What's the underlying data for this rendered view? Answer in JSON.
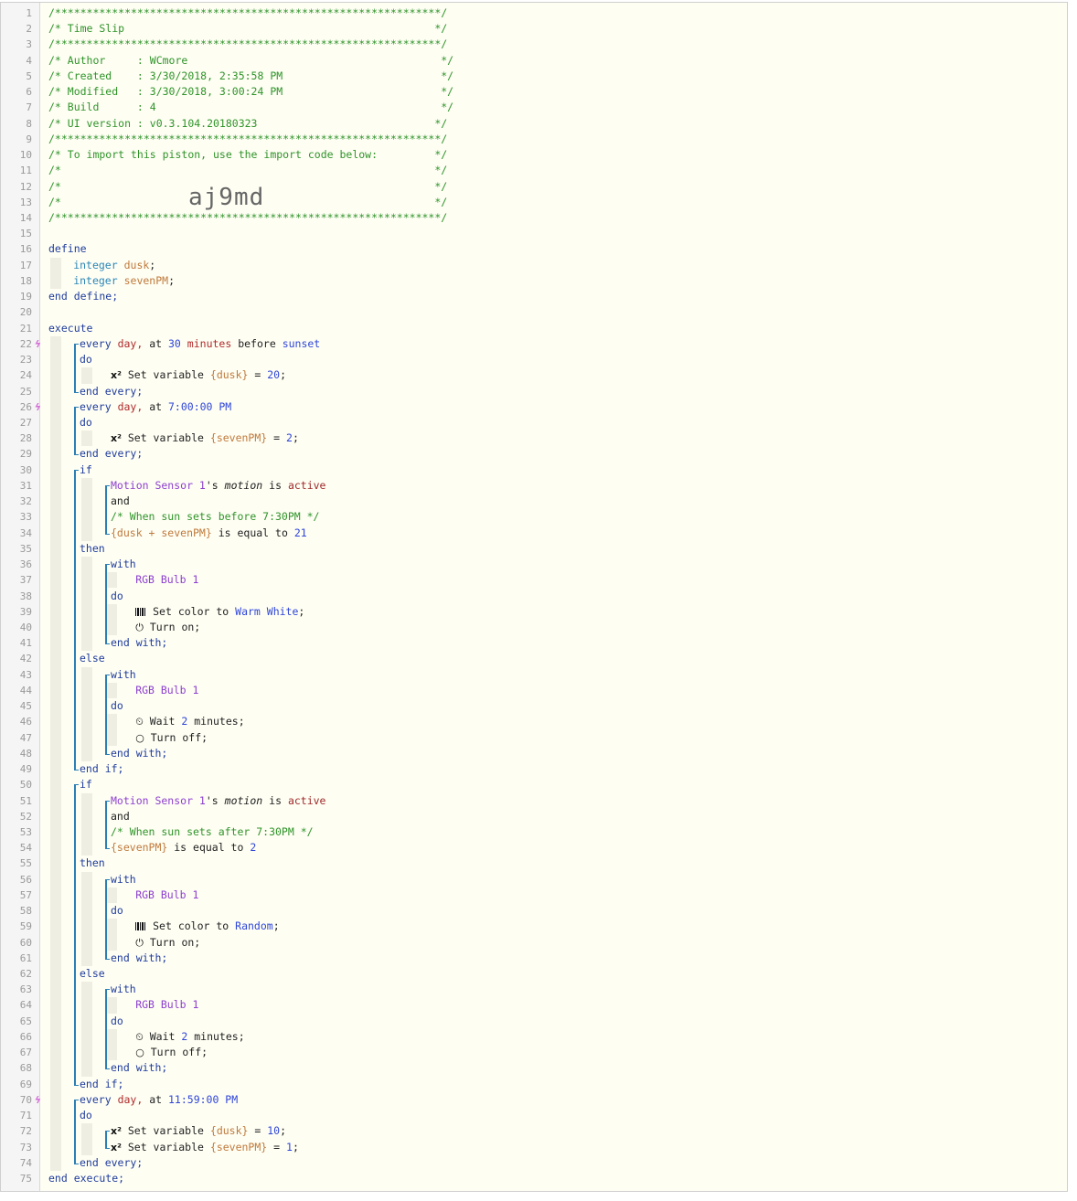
{
  "line_numbers": [
    "1",
    "2",
    "3",
    "4",
    "5",
    "6",
    "7",
    "8",
    "9",
    "10",
    "11",
    "12",
    "13",
    "14",
    "15",
    "16",
    "17",
    "18",
    "19",
    "20",
    "21",
    "22",
    "23",
    "24",
    "25",
    "26",
    "27",
    "28",
    "29",
    "30",
    "31",
    "32",
    "33",
    "34",
    "35",
    "36",
    "37",
    "38",
    "39",
    "40",
    "41",
    "42",
    "43",
    "44",
    "45",
    "46",
    "47",
    "48",
    "49",
    "50",
    "51",
    "52",
    "53",
    "54",
    "55",
    "56",
    "57",
    "58",
    "59",
    "60",
    "61",
    "62",
    "63",
    "64",
    "65",
    "66",
    "67",
    "68",
    "69",
    "70",
    "71",
    "72",
    "73",
    "74",
    "75"
  ],
  "trigger_marker": "ϟ",
  "import_code": "aj9md",
  "header": {
    "border": "/*************************************************************/",
    "title": "/* Time Slip                                                 */",
    "author": "/* Author     : WCmore                                        */",
    "created": "/* Created    : 3/30/2018, 2:35:58 PM                         */",
    "modified": "/* Modified   : 3/30/2018, 3:00:24 PM                         */",
    "build": "/* Build      : 4                                             */",
    "ui_version": "/* UI version : v0.3.104.20180323                            */",
    "import_note": "/* To import this piston, use the import code below:         */",
    "blank": "/*                                                           */"
  },
  "code": {
    "define": "define",
    "integer": "integer",
    "dusk": "dusk",
    "seven_pm": "sevenPM",
    "semicolon": ";",
    "end_define": "end define;",
    "execute": "execute",
    "every": "every",
    "day": "day,",
    "at": "at",
    "thirty": "30",
    "minutes": "minutes",
    "before": "before",
    "sunset": "sunset",
    "do": "do",
    "set_variable": "Set variable",
    "x2": "x²",
    "dusk_ref": "{dusk}",
    "seven_pm_ref": "{sevenPM}",
    "equals": "=",
    "twenty": "20",
    "end_every": "end every;",
    "time_7pm": "7:00:00 PM",
    "two": "2",
    "if": "if",
    "motion_sensor": "Motion Sensor 1",
    "possessive": "'s",
    "motion": "motion",
    "is": "is",
    "active": "active",
    "and": "and",
    "comment_before": "/* When sun sets before 7:30PM */",
    "dusk_plus_seven": "{dusk + sevenPM}",
    "is_equal_to": "is equal to",
    "twenty_one": "21",
    "then": "then",
    "with": "with",
    "rgb_bulb": "RGB Bulb 1",
    "set_color_to": "Set color to",
    "warm_white": "Warm White",
    "turn_on": "Turn on;",
    "end_with": "end with;",
    "else": "else",
    "wait": "Wait",
    "minutes_semi": "minutes;",
    "turn_off": "Turn off;",
    "end_if": "end if;",
    "comment_after": "/* When sun sets after 7:30PM */",
    "random": "Random",
    "time_1159pm": "11:59:00 PM",
    "ten": "10",
    "one": "1",
    "end_execute": "end execute;"
  },
  "icons": {
    "power": "⏻",
    "clock": "⏲",
    "circle": "○"
  }
}
